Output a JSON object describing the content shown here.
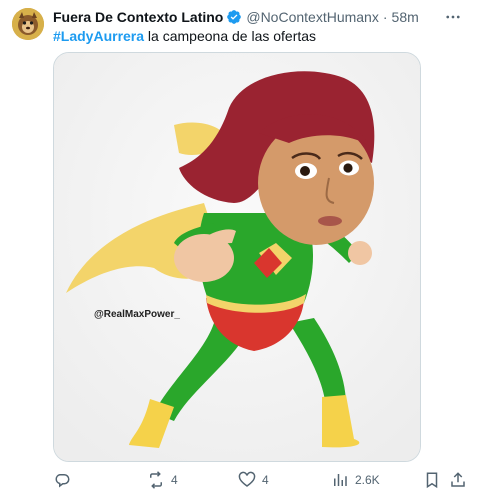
{
  "tweet": {
    "display_name": "Fuera De Contexto Latino",
    "handle": "@NoContextHumanx",
    "separator": "·",
    "time": "58m",
    "hashtag": "#LadyAurrera",
    "text": " la campeona de las ofertas",
    "image_watermark": "@RealMaxPower_",
    "replies": "",
    "retweets": "4",
    "likes": "4",
    "views": "2.6K"
  },
  "colors": {
    "accent": "#1d9bf0",
    "muted": "#536471",
    "verified": "#1d9bf0",
    "suit_green": "#2aa72b",
    "cape_yellow": "#f3d46a",
    "belt_red": "#d9362e"
  },
  "icons": [
    "more-icon",
    "verified-badge-icon",
    "reply-icon",
    "retweet-icon",
    "like-icon",
    "views-icon",
    "bookmark-icon",
    "share-icon"
  ]
}
